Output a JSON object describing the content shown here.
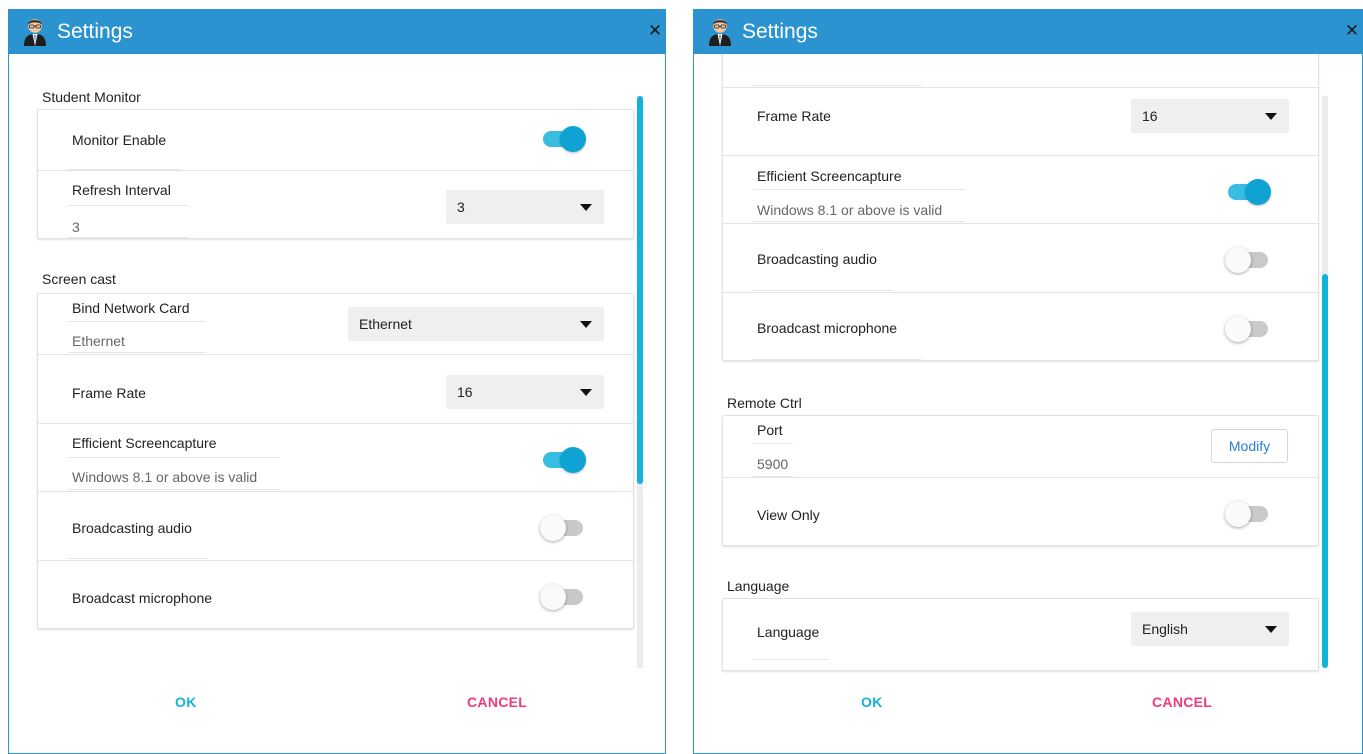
{
  "left": {
    "title": "Settings",
    "sections": {
      "student_monitor": {
        "title": "Student Monitor",
        "monitor_enable": {
          "label": "Monitor Enable",
          "enabled": true
        },
        "refresh_interval": {
          "label": "Refresh Interval",
          "current": "3",
          "selected": "3"
        }
      },
      "screen_cast": {
        "title": "Screen cast",
        "bind_network_card": {
          "label": "Bind Network Card",
          "current": "Ethernet",
          "selected": "Ethernet"
        },
        "frame_rate": {
          "label": "Frame Rate",
          "selected": "16"
        },
        "efficient_screencapture": {
          "label": "Efficient Screencapture",
          "hint": "Windows 8.1 or above is valid",
          "enabled": true
        },
        "broadcasting_audio": {
          "label": "Broadcasting audio",
          "enabled": false
        },
        "broadcast_microphone": {
          "label": "Broadcast microphone",
          "enabled": false
        }
      }
    },
    "ok_label": "OK",
    "cancel_label": "CANCEL"
  },
  "right": {
    "title": "Settings",
    "sections": {
      "screen_cast": {
        "frame_rate": {
          "label": "Frame Rate",
          "selected": "16"
        },
        "efficient_screencapture": {
          "label": "Efficient Screencapture",
          "hint": "Windows 8.1 or above is valid",
          "enabled": true
        },
        "broadcasting_audio": {
          "label": "Broadcasting audio",
          "enabled": false
        },
        "broadcast_microphone": {
          "label": "Broadcast microphone",
          "enabled": false
        }
      },
      "remote_ctrl": {
        "title": "Remote Ctrl",
        "port": {
          "label": "Port",
          "value": "5900",
          "button": "Modify"
        },
        "view_only": {
          "label": "View Only",
          "enabled": false
        }
      },
      "language": {
        "title": "Language",
        "language": {
          "label": "Language",
          "selected": "English"
        }
      }
    },
    "ok_label": "OK",
    "cancel_label": "CANCEL"
  },
  "colors": {
    "titlebar": "#2b93d0",
    "accent": "#13b3d8",
    "cancel": "#ef3b7d"
  },
  "icons": {
    "app": "user-avatar-icon",
    "close": "close-icon",
    "dropdown": "dropdown-caret-icon"
  }
}
